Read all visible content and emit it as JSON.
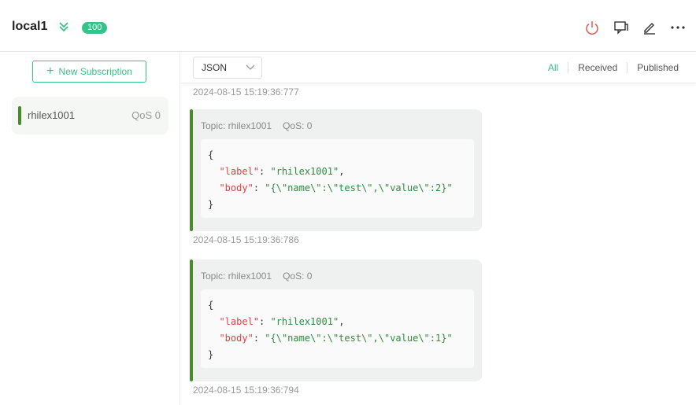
{
  "header": {
    "connection_name": "local1",
    "count_badge": "100",
    "icons": [
      "chevrons-down-icon",
      "power-icon",
      "chat-icon",
      "edit-icon",
      "more-icon"
    ],
    "colors": {
      "accent": "#34c388",
      "power": "#e05a4f"
    }
  },
  "sidebar": {
    "new_subscription_label": "New Subscription",
    "subscriptions": [
      {
        "topic": "rhilex1001",
        "qos": "QoS 0",
        "color": "#4a8c2a"
      }
    ]
  },
  "toolbar": {
    "format_select": "JSON",
    "tabs": [
      "All",
      "Received",
      "Published"
    ],
    "active_tab": "All"
  },
  "messages": {
    "partial_timestamp": "2024-08-15 15:19:36:777",
    "items": [
      {
        "topic": "Topic: rhilex1001",
        "qos": "QoS: 0",
        "open_brace": "{",
        "label_key": "\"label\"",
        "label_val": "\"rhilex1001\"",
        "body_key": "\"body\"",
        "body_val": "\"{\\\"name\\\":\\\"test\\\",\\\"value\\\":2}\"",
        "close_brace": "}",
        "timestamp": "2024-08-15 15:19:36:786"
      },
      {
        "topic": "Topic: rhilex1001",
        "qos": "QoS: 0",
        "open_brace": "{",
        "label_key": "\"label\"",
        "label_val": "\"rhilex1001\"",
        "body_key": "\"body\"",
        "body_val": "\"{\\\"name\\\":\\\"test\\\",\\\"value\\\":1}\"",
        "close_brace": "}",
        "timestamp": "2024-08-15 15:19:36:794"
      }
    ]
  }
}
